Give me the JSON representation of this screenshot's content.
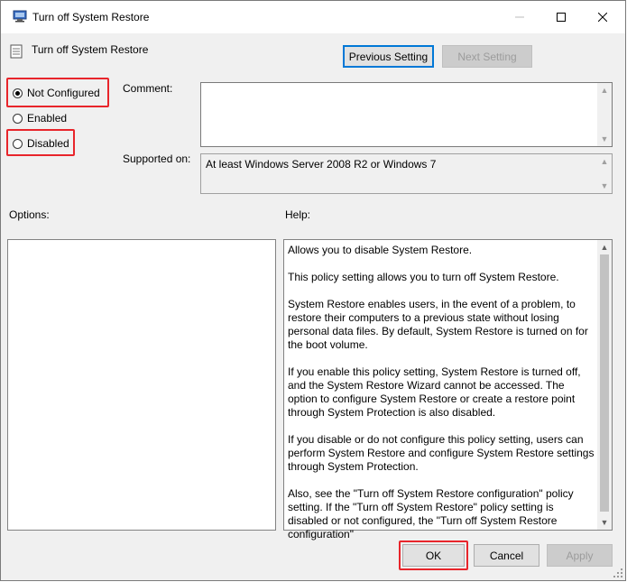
{
  "window": {
    "title": "Turn off System Restore",
    "minimize_icon": "minimize-icon",
    "maximize_icon": "maximize-icon",
    "close_icon": "close-icon"
  },
  "header": {
    "policy_name": "Turn off System Restore",
    "prev_button": "Previous Setting",
    "next_button": "Next Setting"
  },
  "state": {
    "options": [
      "Not Configured",
      "Enabled",
      "Disabled"
    ],
    "selected": "Not Configured"
  },
  "fields": {
    "comment_label": "Comment:",
    "comment_value": "",
    "supported_label": "Supported on:",
    "supported_value": "At least Windows Server 2008 R2 or Windows 7"
  },
  "panes": {
    "options_label": "Options:",
    "help_label": "Help:",
    "help_paragraphs": [
      "Allows you to disable System Restore.",
      "This policy setting allows you to turn off System Restore.",
      "System Restore enables users, in the event of a problem, to restore their computers to a previous state without losing personal data files. By default, System Restore is turned on for the boot volume.",
      "If you enable this policy setting, System Restore is turned off, and the System Restore Wizard cannot be accessed. The option to configure System Restore or create a restore point through System Protection is also disabled.",
      "If you disable or do not configure this policy setting, users can perform System Restore and configure System Restore settings through System Protection.",
      "Also, see the \"Turn off System Restore configuration\" policy setting. If the \"Turn off System Restore\" policy setting is disabled or not configured, the \"Turn off System Restore configuration\""
    ]
  },
  "footer": {
    "ok": "OK",
    "cancel": "Cancel",
    "apply": "Apply"
  },
  "colors": {
    "highlight_red": "#e8252b",
    "focus_blue": "#0078d7"
  }
}
